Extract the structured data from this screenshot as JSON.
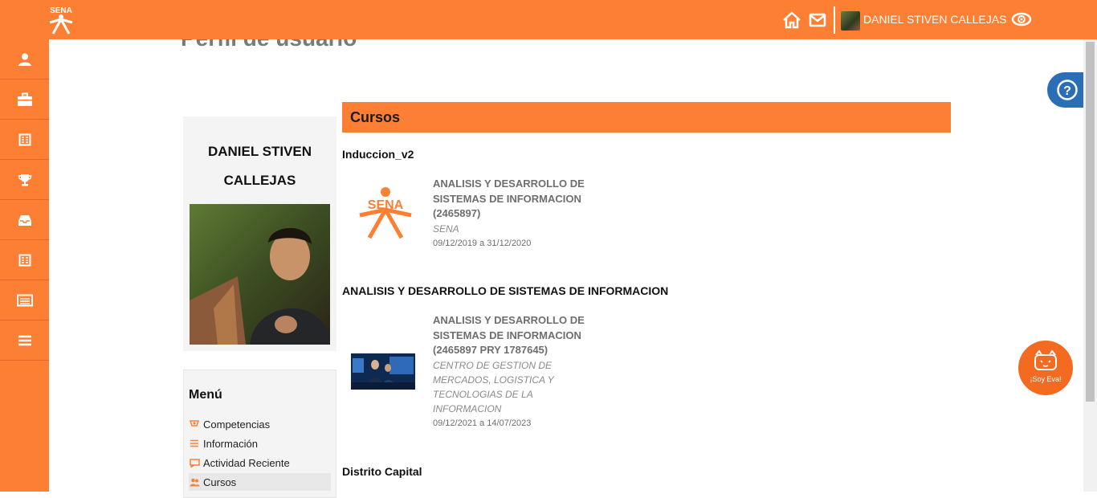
{
  "header": {
    "logo_text": "SENA",
    "user_name": "DANIEL STIVEN CALLEJAS",
    "icons": [
      "home-icon",
      "mail-icon",
      "eye-icon"
    ]
  },
  "sidebar": {
    "items": [
      {
        "icon": "user-icon"
      },
      {
        "icon": "briefcase-icon"
      },
      {
        "icon": "calendar-icon"
      },
      {
        "icon": "trophy-icon"
      },
      {
        "icon": "inbox-icon"
      },
      {
        "icon": "calendar-icon"
      },
      {
        "icon": "card-icon"
      },
      {
        "icon": "hamburger-icon"
      }
    ]
  },
  "page": {
    "title": "Perfil de usuario"
  },
  "profile": {
    "name_line1": "DANIEL STIVEN",
    "name_line2": "CALLEJAS"
  },
  "menu": {
    "title": "Menú",
    "items": [
      {
        "label": "Competencias",
        "icon": "competencies-icon"
      },
      {
        "label": "Información",
        "icon": "list-icon"
      },
      {
        "label": "Actividad Reciente",
        "icon": "activity-icon"
      },
      {
        "label": "Cursos",
        "icon": "users-icon"
      }
    ]
  },
  "courses": {
    "header": "Cursos",
    "groups": [
      {
        "title": "Induccion_v2",
        "course": {
          "name_lines": [
            "ANALISIS Y DESARROLLO DE",
            "SISTEMAS DE INFORMACION",
            "(2465897)"
          ],
          "org_lines": [
            "SENA"
          ],
          "dates": "09/12/2019 a 31/12/2020"
        }
      },
      {
        "title": "ANALISIS Y DESARROLLO DE SISTEMAS DE INFORMACION",
        "course": {
          "name_lines": [
            "ANALISIS Y DESARROLLO DE",
            "SISTEMAS DE INFORMACION",
            "(2465897 PRY 1787645)"
          ],
          "org_lines": [
            "CENTRO DE GESTION DE",
            "MERCADOS, LOGISTICA Y",
            "TECNOLOGIAS DE LA",
            "INFORMACION"
          ],
          "dates": "09/12/2021 a 14/07/2023"
        }
      },
      {
        "title": "Distrito Capital"
      }
    ]
  },
  "widgets": {
    "help": "?",
    "eva_label": "¡Soy Eva!"
  },
  "colors": {
    "brand_orange": "#fc7f33",
    "help_blue": "#2a6fb5"
  }
}
